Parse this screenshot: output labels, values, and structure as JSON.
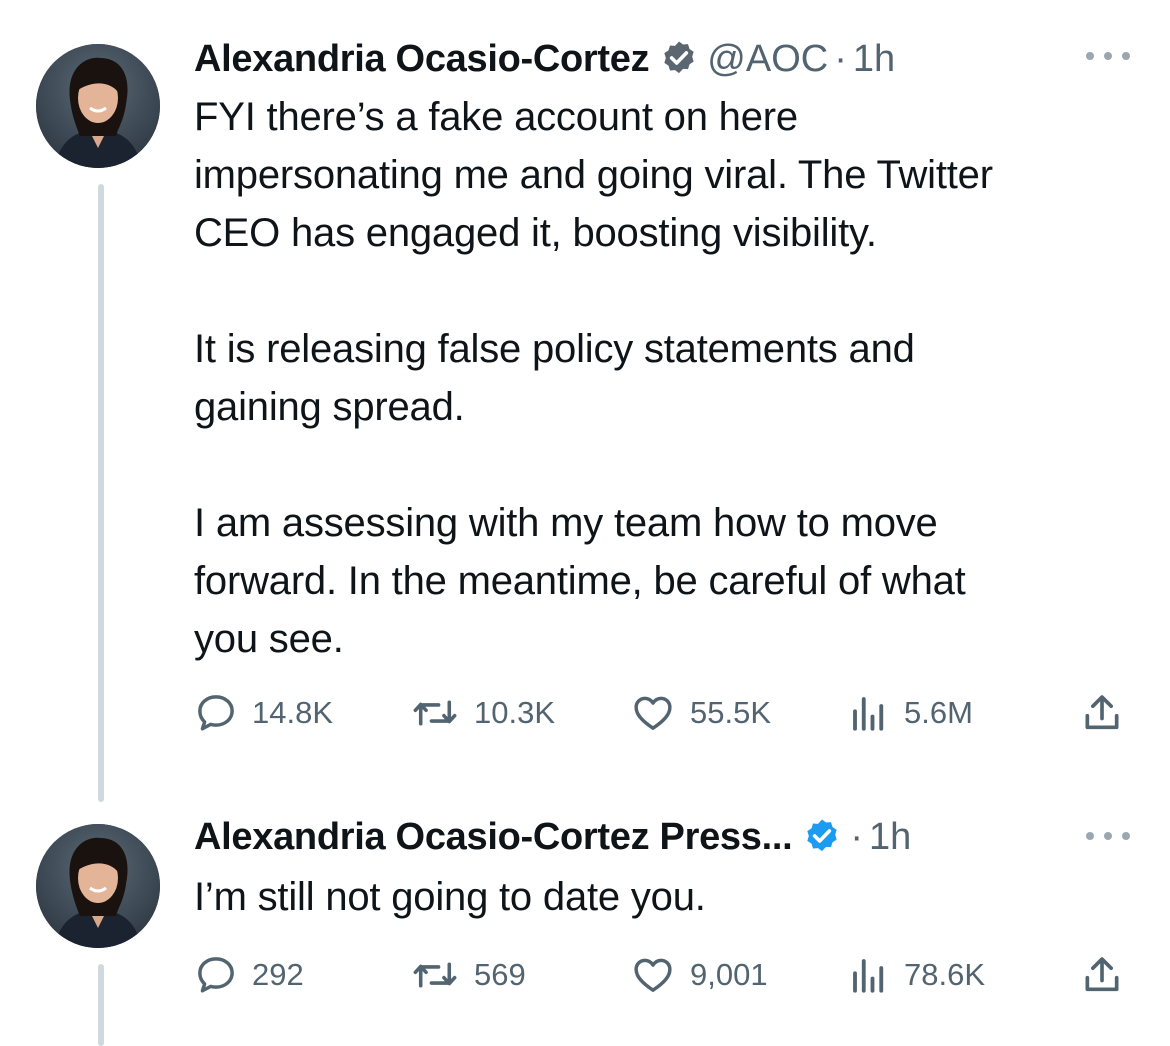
{
  "tweets": [
    {
      "author": {
        "name": "Alexandria Ocasio-Cortez",
        "verified_color": "#1d9bf0",
        "verified_badge_color": "#5b6670",
        "handle": "@AOC"
      },
      "separator": "·",
      "time": "1h",
      "text": "FYI there’s a fake account on here\nimpersonating me and going viral. The Twitter\nCEO has engaged it, boosting visibility.\n\nIt is releasing false policy statements and\ngaining spread.\n\nI am assessing with my team how to move\nforward. In the meantime, be careful of what\nyou see.",
      "actions": {
        "replies": "14.8K",
        "retweets": "10.3K",
        "likes": "55.5K",
        "views": "5.6M"
      }
    },
    {
      "author": {
        "name": "Alexandria Ocasio-Cortez Press...",
        "verified_color": "#1d9bf0",
        "handle": ""
      },
      "separator": "·",
      "time": "1h",
      "text": "I’m still not going to date you.",
      "actions": {
        "replies": "292",
        "retweets": "569",
        "likes": "9,001",
        "views": "78.6K"
      }
    }
  ],
  "icons": {
    "more": "more-horizontal-icon",
    "reply": "speech-bubble-icon",
    "retweet": "retweet-arrows-icon",
    "like": "heart-icon",
    "views": "bar-chart-icon",
    "share": "share-upload-icon"
  },
  "colors": {
    "text": "#0f1419",
    "secondary": "#536471",
    "thread_line": "#cfd9de"
  }
}
